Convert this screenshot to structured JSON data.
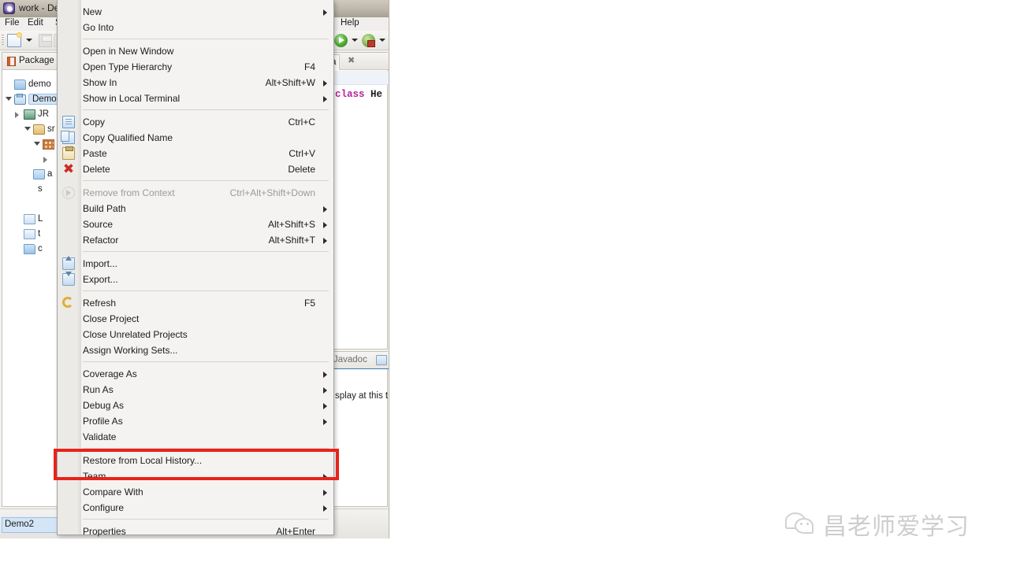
{
  "window": {
    "title": "work - De",
    "app_icon": "eclipse-icon"
  },
  "menubar": {
    "items": [
      {
        "label": "File"
      },
      {
        "label": "Edit"
      },
      {
        "label": "S"
      },
      {
        "label": "Help"
      }
    ]
  },
  "toolbar": {
    "new_icon": "new-wizard-icon",
    "new_dropdown_icon": "chevron-down-icon",
    "save_icon": "save-icon",
    "save_all_icon": "save-all-icon",
    "run_icon": "run-icon",
    "run_dropdown_icon": "chevron-down-icon",
    "debug_icon": "debug-icon",
    "debug_dropdown_icon": "chevron-down-icon"
  },
  "package_explorer": {
    "tab_label": "Package",
    "tab_icon": "package-explorer-icon",
    "tree": [
      {
        "label": "demo",
        "icon": "folder-icon",
        "indent": 0,
        "twisty": "none",
        "selected": false
      },
      {
        "label": "Demo",
        "icon": "project-icon",
        "indent": 0,
        "twisty": "open",
        "selected": true
      },
      {
        "label": "JR",
        "icon": "jre-library-icon",
        "indent": 1,
        "twisty": "closed",
        "selected": false
      },
      {
        "label": "sr",
        "icon": "source-folder-icon",
        "indent": 2,
        "twisty": "open",
        "selected": false
      },
      {
        "label": "",
        "icon": "package-icon",
        "indent": 3,
        "twisty": "open",
        "selected": false
      },
      {
        "label": "",
        "icon": "none",
        "indent": 4,
        "twisty": "closed",
        "selected": false
      },
      {
        "label": "a",
        "icon": "file-icon",
        "indent": 2,
        "twisty": "none",
        "selected": false
      },
      {
        "label": "s",
        "icon": "none",
        "indent": 1,
        "twisty": "none",
        "selected": false
      },
      {
        "label": "",
        "icon": "none",
        "indent": 2,
        "twisty": "none",
        "selected": false
      },
      {
        "label": "L",
        "icon": "doc-icon",
        "indent": 1,
        "twisty": "none",
        "selected": false
      },
      {
        "label": "t",
        "icon": "doc-icon",
        "indent": 1,
        "twisty": "none",
        "selected": false
      },
      {
        "label": "c",
        "icon": "folder-icon",
        "indent": 1,
        "twisty": "none",
        "selected": false
      }
    ]
  },
  "editor": {
    "tab_label": "a",
    "tab_close_icon": "close-icon",
    "code_keyword": "class",
    "code_classname": "He"
  },
  "javadoc_view": {
    "tab_label": "Javadoc",
    "tab_icon": "javadoc-icon",
    "body_text": "splay at this t"
  },
  "statusbar": {
    "selection": "Demo2"
  },
  "context_menu": {
    "items": [
      {
        "label": "New",
        "accel": "",
        "icon": "",
        "submenu": true,
        "disabled": false,
        "sep_after": false
      },
      {
        "label": "Go Into",
        "accel": "",
        "icon": "",
        "submenu": false,
        "disabled": false,
        "sep_after": true
      },
      {
        "label": "Open in New Window",
        "accel": "",
        "icon": "",
        "submenu": false,
        "disabled": false,
        "sep_after": false
      },
      {
        "label": "Open Type Hierarchy",
        "accel": "F4",
        "icon": "",
        "submenu": false,
        "disabled": false,
        "sep_after": false
      },
      {
        "label": "Show In",
        "accel": "Alt+Shift+W",
        "icon": "",
        "submenu": true,
        "disabled": false,
        "sep_after": false
      },
      {
        "label": "Show in Local Terminal",
        "accel": "",
        "icon": "",
        "submenu": true,
        "disabled": false,
        "sep_after": true
      },
      {
        "label": "Copy",
        "accel": "Ctrl+C",
        "icon": "copy-icon",
        "submenu": false,
        "disabled": false,
        "sep_after": false
      },
      {
        "label": "Copy Qualified Name",
        "accel": "",
        "icon": "copy-qualified-name-icon",
        "submenu": false,
        "disabled": false,
        "sep_after": false
      },
      {
        "label": "Paste",
        "accel": "Ctrl+V",
        "icon": "paste-icon",
        "submenu": false,
        "disabled": false,
        "sep_after": false
      },
      {
        "label": "Delete",
        "accel": "Delete",
        "icon": "delete-icon",
        "submenu": false,
        "disabled": false,
        "sep_after": true
      },
      {
        "label": "Remove from Context",
        "accel": "Ctrl+Alt+Shift+Down",
        "icon": "remove-from-context-icon",
        "submenu": false,
        "disabled": true,
        "sep_after": false
      },
      {
        "label": "Build Path",
        "accel": "",
        "icon": "",
        "submenu": true,
        "disabled": false,
        "sep_after": false
      },
      {
        "label": "Source",
        "accel": "Alt+Shift+S",
        "icon": "",
        "submenu": true,
        "disabled": false,
        "sep_after": false
      },
      {
        "label": "Refactor",
        "accel": "Alt+Shift+T",
        "icon": "",
        "submenu": true,
        "disabled": false,
        "sep_after": true
      },
      {
        "label": "Import...",
        "accel": "",
        "icon": "import-icon",
        "submenu": false,
        "disabled": false,
        "sep_after": false
      },
      {
        "label": "Export...",
        "accel": "",
        "icon": "export-icon",
        "submenu": false,
        "disabled": false,
        "sep_after": true
      },
      {
        "label": "Refresh",
        "accel": "F5",
        "icon": "refresh-icon",
        "submenu": false,
        "disabled": false,
        "sep_after": false
      },
      {
        "label": "Close Project",
        "accel": "",
        "icon": "",
        "submenu": false,
        "disabled": false,
        "sep_after": false
      },
      {
        "label": "Close Unrelated Projects",
        "accel": "",
        "icon": "",
        "submenu": false,
        "disabled": false,
        "sep_after": false
      },
      {
        "label": "Assign Working Sets...",
        "accel": "",
        "icon": "",
        "submenu": false,
        "disabled": false,
        "sep_after": true
      },
      {
        "label": "Coverage As",
        "accel": "",
        "icon": "",
        "submenu": true,
        "disabled": false,
        "sep_after": false
      },
      {
        "label": "Run As",
        "accel": "",
        "icon": "",
        "submenu": true,
        "disabled": false,
        "sep_after": false
      },
      {
        "label": "Debug As",
        "accel": "",
        "icon": "",
        "submenu": true,
        "disabled": false,
        "sep_after": false
      },
      {
        "label": "Profile As",
        "accel": "",
        "icon": "",
        "submenu": true,
        "disabled": false,
        "sep_after": false
      },
      {
        "label": "Validate",
        "accel": "",
        "icon": "",
        "submenu": false,
        "disabled": false,
        "sep_after": true
      },
      {
        "label": "Restore from Local History...",
        "accel": "",
        "icon": "",
        "submenu": false,
        "disabled": false,
        "sep_after": false
      },
      {
        "label": "Team",
        "accel": "",
        "icon": "",
        "submenu": true,
        "disabled": false,
        "sep_after": false
      },
      {
        "label": "Compare With",
        "accel": "",
        "icon": "",
        "submenu": true,
        "disabled": false,
        "sep_after": false
      },
      {
        "label": "Configure",
        "accel": "",
        "icon": "",
        "submenu": true,
        "disabled": false,
        "sep_after": true
      },
      {
        "label": "Properties",
        "accel": "Alt+Enter",
        "icon": "",
        "submenu": false,
        "disabled": false,
        "sep_after": false
      }
    ]
  },
  "annotation": {
    "highlight_color": "#e8231a",
    "highlights": [
      "Restore from Local History...",
      "Team"
    ]
  },
  "watermark": {
    "text": "昌老师爱学习",
    "logo": "wechat-icon"
  }
}
